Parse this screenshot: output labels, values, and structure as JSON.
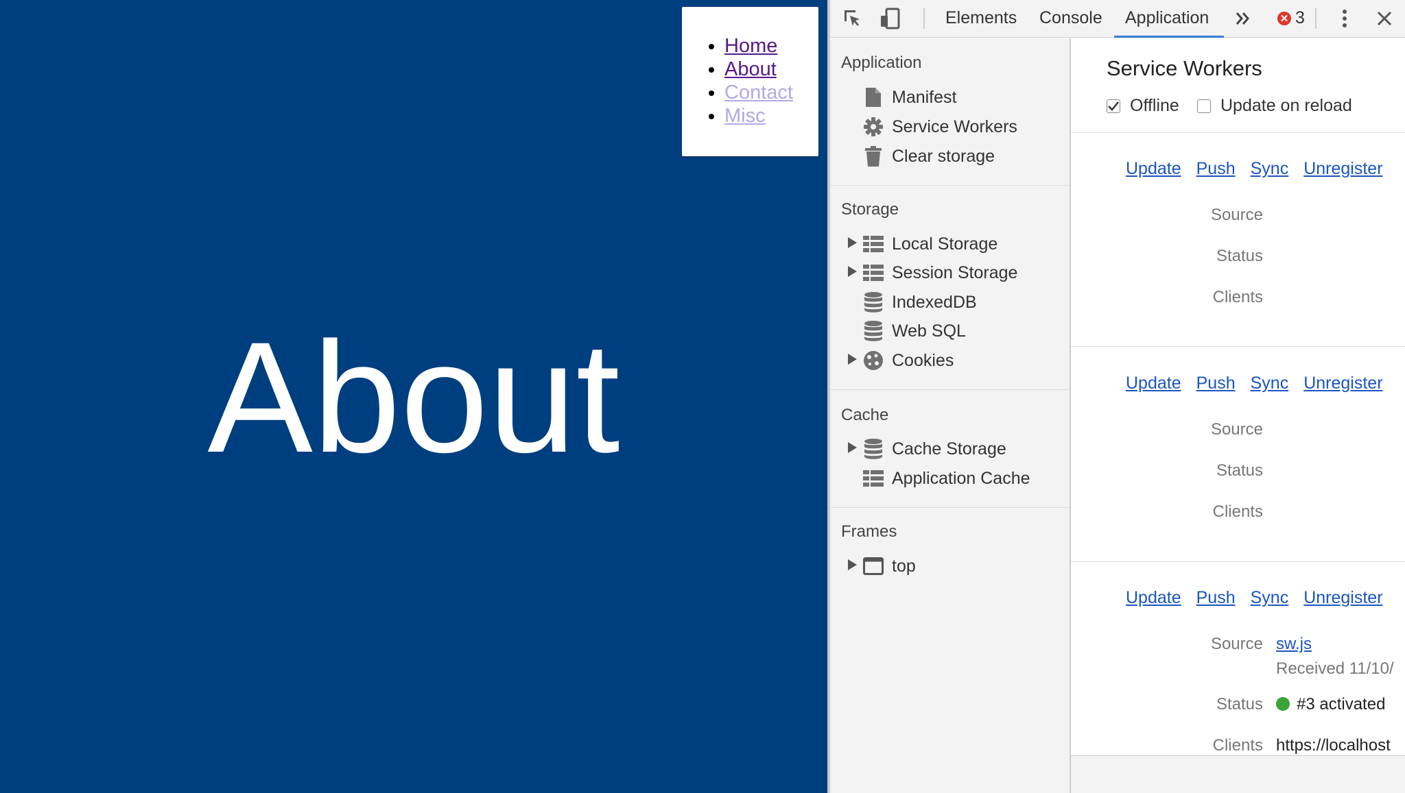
{
  "page": {
    "heading": "About",
    "nav": [
      {
        "label": "Home",
        "state": "visited"
      },
      {
        "label": "About",
        "state": "visited"
      },
      {
        "label": "Contact",
        "state": "faded"
      },
      {
        "label": "Misc",
        "state": "faded"
      }
    ],
    "background_color": "#003f7f"
  },
  "devtools": {
    "tabs": [
      "Elements",
      "Console",
      "Application"
    ],
    "active_tab": "Application",
    "error_count": "3",
    "sidebar": {
      "application": {
        "title": "Application",
        "items": [
          {
            "label": "Manifest",
            "icon": "file-icon"
          },
          {
            "label": "Service Workers",
            "icon": "gear-icon"
          },
          {
            "label": "Clear storage",
            "icon": "trash-icon"
          }
        ]
      },
      "storage": {
        "title": "Storage",
        "items": [
          {
            "label": "Local Storage",
            "icon": "grid-icon",
            "expandable": true
          },
          {
            "label": "Session Storage",
            "icon": "grid-icon",
            "expandable": true
          },
          {
            "label": "IndexedDB",
            "icon": "database-icon",
            "expandable": false
          },
          {
            "label": "Web SQL",
            "icon": "database-icon",
            "expandable": false
          },
          {
            "label": "Cookies",
            "icon": "cookie-icon",
            "expandable": true
          }
        ]
      },
      "cache": {
        "title": "Cache",
        "items": [
          {
            "label": "Cache Storage",
            "icon": "database-icon",
            "expandable": true
          },
          {
            "label": "Application Cache",
            "icon": "grid-icon",
            "expandable": false
          }
        ]
      },
      "frames": {
        "title": "Frames",
        "items": [
          {
            "label": "top",
            "icon": "frame-icon",
            "expandable": true
          }
        ]
      }
    },
    "main": {
      "title": "Service Workers",
      "offline_label": "Offline",
      "offline_checked": true,
      "update_on_reload_label": "Update on reload",
      "update_on_reload_checked": false,
      "actions": [
        "Update",
        "Push",
        "Sync",
        "Unregister"
      ],
      "labels": {
        "source": "Source",
        "status": "Status",
        "clients": "Clients"
      },
      "workers": [
        {
          "source": "",
          "received": "",
          "status": "",
          "clients": ""
        },
        {
          "source": "",
          "received": "",
          "status": "",
          "clients": ""
        },
        {
          "source": "sw.js",
          "received": "Received 11/10/",
          "status": "#3 activated",
          "clients": "https://localhost"
        }
      ],
      "status_color": "#3aa33a"
    }
  }
}
